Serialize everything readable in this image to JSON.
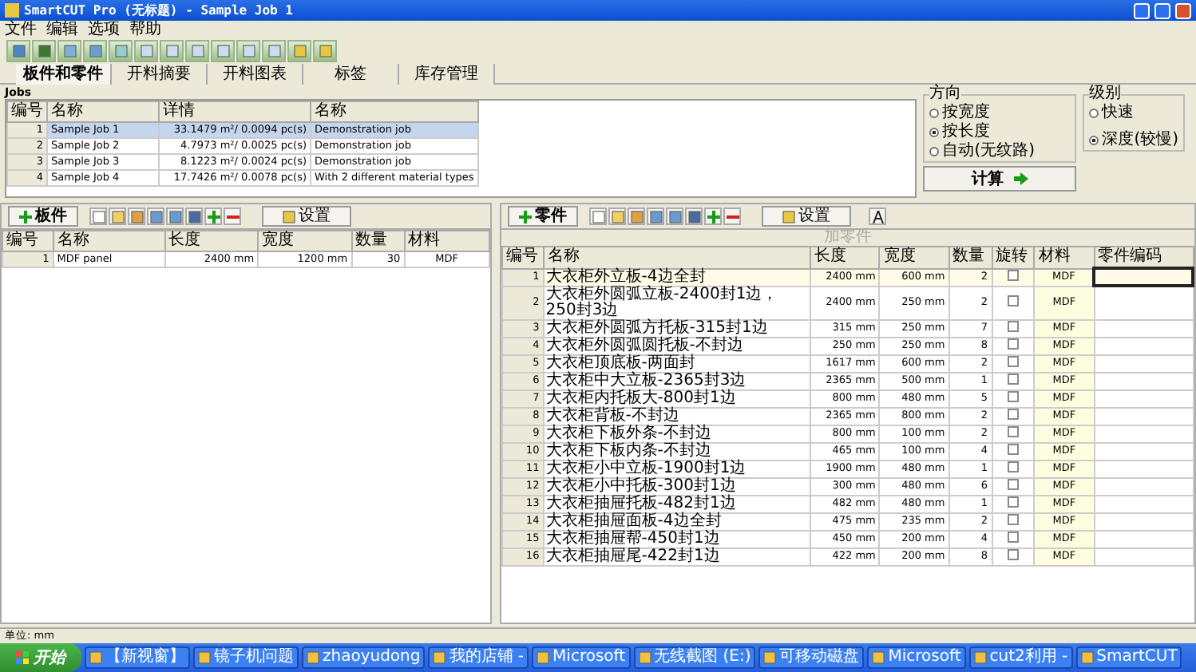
{
  "window": {
    "title": "SmartCUT Pro (无标题) - Sample Job 1"
  },
  "menu": [
    "文件",
    "编辑",
    "选项",
    "帮助"
  ],
  "tabs": [
    {
      "label": "板件和零件",
      "selected": true
    },
    {
      "label": "开料摘要",
      "selected": false
    },
    {
      "label": "开料图表",
      "selected": false
    },
    {
      "label": "标签",
      "selected": false
    },
    {
      "label": "库存管理",
      "selected": false
    }
  ],
  "jobs": {
    "title": "Jobs",
    "columns": [
      "编号",
      "名称",
      "详情",
      "名称"
    ],
    "rows": [
      {
        "cells": [
          "1",
          "Sample Job 1",
          "33.1479 m²/ 0.0094 pc(s)",
          "Demonstration job"
        ],
        "selected": true
      },
      {
        "cells": [
          "2",
          "Sample Job 2",
          "4.7973 m²/ 0.0025 pc(s)",
          "Demonstration job"
        ],
        "selected": false
      },
      {
        "cells": [
          "3",
          "Sample Job 3",
          "8.1223 m²/ 0.0024 pc(s)",
          "Demonstration job"
        ],
        "selected": false
      },
      {
        "cells": [
          "4",
          "Sample Job 4",
          "17.7426 m²/ 0.0078 pc(s)",
          "With 2 different material types"
        ],
        "selected": false
      }
    ]
  },
  "direction": {
    "title": "方向",
    "options": [
      {
        "label": "按宽度",
        "selected": false
      },
      {
        "label": "按长度",
        "selected": true
      },
      {
        "label": "自动(无纹路)",
        "selected": false
      }
    ]
  },
  "level": {
    "title": "级别",
    "options": [
      {
        "label": "快速",
        "selected": false
      },
      {
        "label": "深度(较慢)",
        "selected": true
      }
    ]
  },
  "calculate": "计算",
  "boards": {
    "add": "板件",
    "settings": "设置",
    "columns": [
      "编号",
      "名称",
      "长度",
      "宽度",
      "数量",
      "材料"
    ],
    "rows": [
      [
        "1",
        "MDF panel",
        "2400 mm",
        "1200 mm",
        "30",
        "MDF"
      ]
    ]
  },
  "parts": {
    "add": "零件",
    "settings": "设置",
    "caption": "加零件",
    "columns": [
      "编号",
      "名称",
      "长度",
      "宽度",
      "数量",
      "旋转",
      "材料",
      "零件编码"
    ],
    "rows": [
      {
        "no": "1",
        "name": "大衣柜外立板-4边全封",
        "length": "2400 mm",
        "width": "600 mm",
        "qty": "2",
        "rotate": false,
        "material": "MDF"
      },
      {
        "no": "2",
        "name": "大衣柜外圆弧立板-2400封1边，250封3边",
        "length": "2400 mm",
        "width": "250 mm",
        "qty": "2",
        "rotate": false,
        "material": "MDF"
      },
      {
        "no": "3",
        "name": "大衣柜外圆弧方托板-315封1边",
        "length": "315 mm",
        "width": "250 mm",
        "qty": "7",
        "rotate": false,
        "material": "MDF"
      },
      {
        "no": "4",
        "name": "大衣柜外圆弧圆托板-不封边",
        "length": "250 mm",
        "width": "250 mm",
        "qty": "8",
        "rotate": false,
        "material": "MDF"
      },
      {
        "no": "5",
        "name": "大衣柜顶底板-两面封",
        "length": "1617 mm",
        "width": "600 mm",
        "qty": "2",
        "rotate": false,
        "material": "MDF"
      },
      {
        "no": "6",
        "name": "大衣柜中大立板-2365封3边",
        "length": "2365 mm",
        "width": "500 mm",
        "qty": "1",
        "rotate": false,
        "material": "MDF"
      },
      {
        "no": "7",
        "name": "大衣柜内托板大-800封1边",
        "length": "800 mm",
        "width": "480 mm",
        "qty": "5",
        "rotate": false,
        "material": "MDF"
      },
      {
        "no": "8",
        "name": "大衣柜背板-不封边",
        "length": "2365 mm",
        "width": "800 mm",
        "qty": "2",
        "rotate": false,
        "material": "MDF"
      },
      {
        "no": "9",
        "name": "大衣柜下板外条-不封边",
        "length": "800 mm",
        "width": "100 mm",
        "qty": "2",
        "rotate": false,
        "material": "MDF"
      },
      {
        "no": "10",
        "name": "大衣柜下板内条-不封边",
        "length": "465 mm",
        "width": "100 mm",
        "qty": "4",
        "rotate": false,
        "material": "MDF"
      },
      {
        "no": "11",
        "name": "大衣柜小中立板-1900封1边",
        "length": "1900 mm",
        "width": "480 mm",
        "qty": "1",
        "rotate": false,
        "material": "MDF"
      },
      {
        "no": "12",
        "name": "大衣柜小中托板-300封1边",
        "length": "300 mm",
        "width": "480 mm",
        "qty": "6",
        "rotate": false,
        "material": "MDF"
      },
      {
        "no": "13",
        "name": "大衣柜抽屉托板-482封1边",
        "length": "482 mm",
        "width": "480 mm",
        "qty": "1",
        "rotate": false,
        "material": "MDF"
      },
      {
        "no": "14",
        "name": "大衣柜抽屉面板-4边全封",
        "length": "475 mm",
        "width": "235 mm",
        "qty": "2",
        "rotate": false,
        "material": "MDF"
      },
      {
        "no": "15",
        "name": "大衣柜抽屉帮-450封1边",
        "length": "450 mm",
        "width": "200 mm",
        "qty": "4",
        "rotate": false,
        "material": "MDF"
      },
      {
        "no": "16",
        "name": "大衣柜抽屉尾-422封1边",
        "length": "422 mm",
        "width": "200 mm",
        "qty": "8",
        "rotate": false,
        "material": "MDF"
      }
    ]
  },
  "status_bar": "单位: mm",
  "taskbar": {
    "start": "开始",
    "items": [
      "【新视窗】",
      "镜子机问题",
      "zhaoyudong",
      "我的店铺 -",
      "Microsoft",
      "无线截图 (E:)",
      "可移动磁盘",
      "Microsoft",
      "cut2利用 -",
      "SmartCUT"
    ]
  }
}
